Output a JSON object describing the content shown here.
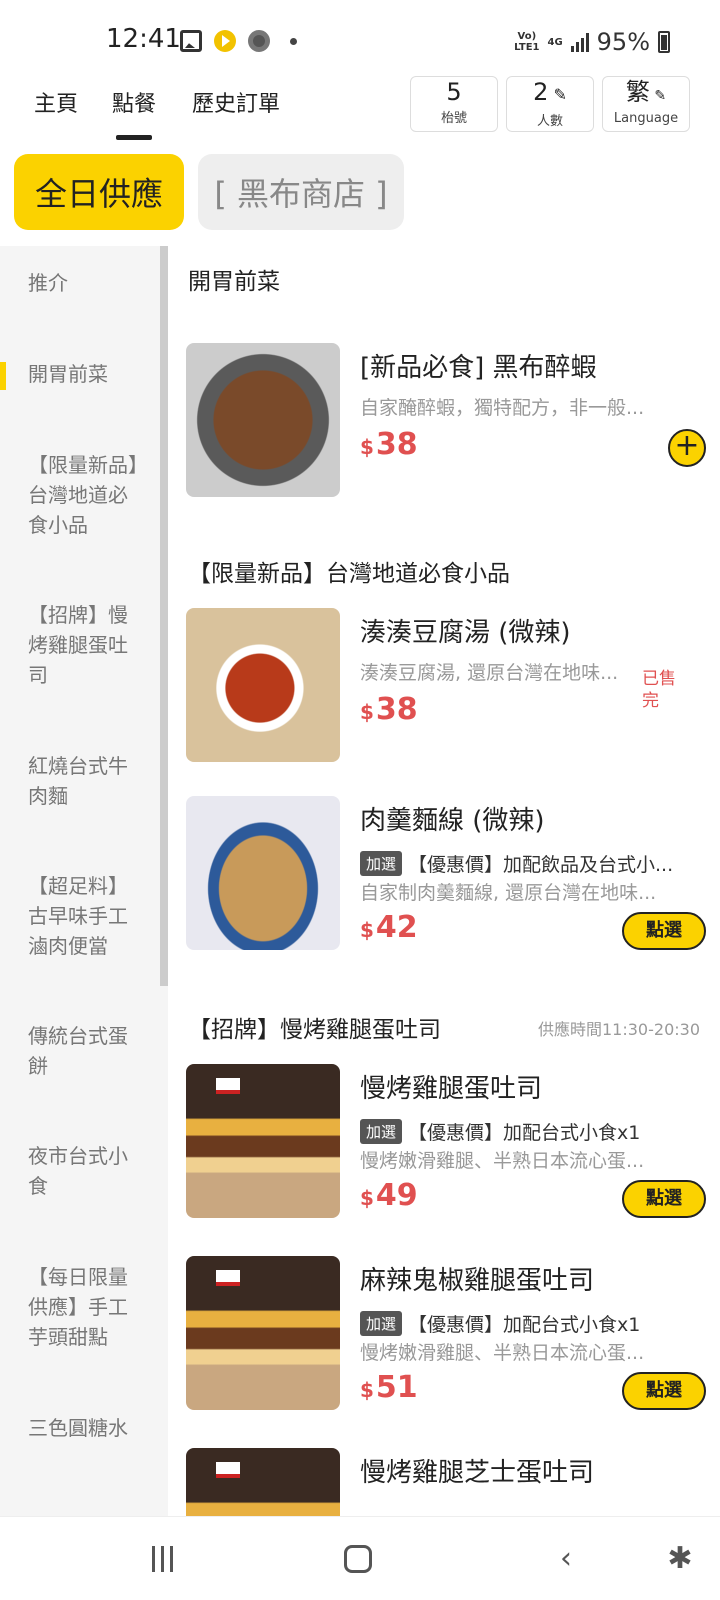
{
  "status_bar": {
    "time": "12:41",
    "network_top": "Vo)",
    "network_bottom": "LTE1",
    "network_type": "4G",
    "battery": "95%"
  },
  "top_nav": {
    "tabs": [
      {
        "label": "主頁"
      },
      {
        "label": "點餐"
      },
      {
        "label": "歷史訂單"
      }
    ],
    "table": {
      "value": "5",
      "label": "枱號"
    },
    "people": {
      "value": "2",
      "label": "人數"
    },
    "language": {
      "value": "繁",
      "label": "Language"
    }
  },
  "chips": {
    "primary": "全日供應",
    "secondary": "[ 黑布商店 ]"
  },
  "sidebar": {
    "items": [
      {
        "label": "推介"
      },
      {
        "label": "開胃前菜"
      },
      {
        "label": "【限量新品】台灣地道必食小品"
      },
      {
        "label": "【招牌】慢烤雞腿蛋吐司"
      },
      {
        "label": "紅燒台式牛肉麵"
      },
      {
        "label": "【超足料】古早味手工滷肉便當"
      },
      {
        "label": "傳統台式蛋餅"
      },
      {
        "label": "夜市台式小食"
      },
      {
        "label": "【每日限量供應】手工芋頭甜點"
      },
      {
        "label": "三色圓糖水"
      }
    ]
  },
  "sections": {
    "appetizers": {
      "title": "開胃前菜"
    },
    "limited": {
      "title": "【限量新品】台灣地道必食小品"
    },
    "signature": {
      "title": "【招牌】慢烤雞腿蛋吐司",
      "note": "供應時間11:30-20:30"
    }
  },
  "items": [
    {
      "name": "[新品必食] 黑布醉蝦",
      "desc": "自家醃醉蝦，獨特配方，非一般...",
      "currency": "$",
      "price": "38",
      "action": "+"
    },
    {
      "name": "湊湊豆腐湯 (微辣)",
      "desc": "湊湊豆腐湯, 還原台灣在地味...",
      "currency": "$",
      "price": "38",
      "soldout": "已售完"
    },
    {
      "name": "肉羹麵線 (微辣)",
      "addon_tag": "加選",
      "addon_text": "【優惠價】加配飲品及台式小...",
      "desc": "自家制肉羹麵線, 還原台灣在地味...",
      "currency": "$",
      "price": "42",
      "action": "點選"
    },
    {
      "name": "慢烤雞腿蛋吐司",
      "addon_tag": "加選",
      "addon_text": "【優惠價】加配台式小食x1",
      "desc": "慢烤嫩滑雞腿、半熟日本流心蛋...",
      "currency": "$",
      "price": "49",
      "action": "點選"
    },
    {
      "name": "麻辣鬼椒雞腿蛋吐司",
      "addon_tag": "加選",
      "addon_text": "【優惠價】加配台式小食x1",
      "desc": "慢烤嫩滑雞腿、半熟日本流心蛋...",
      "currency": "$",
      "price": "51",
      "action": "點選"
    },
    {
      "name": "慢烤雞腿芝士蛋吐司"
    }
  ],
  "icons": {
    "status": [
      "photo-icon",
      "play-icon",
      "chrome-icon",
      "notification-dot-icon",
      "signal-icon",
      "battery-icon"
    ],
    "bottom": [
      "recent-apps-icon",
      "home-icon",
      "back-icon",
      "accessibility-icon"
    ],
    "people_edit": "pencil-icon",
    "language_edit": "pencil-icon"
  },
  "colors": {
    "accent": "#fbd200",
    "price": "#e05050",
    "soldout": "#e05050"
  }
}
